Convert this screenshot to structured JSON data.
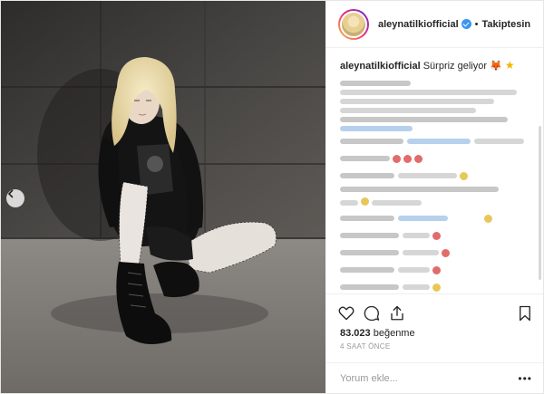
{
  "post": {
    "username": "aleynatilkiofficial",
    "follow_status": "Takiptesin",
    "separator": "•",
    "caption_user": "aleynatilkiofficial",
    "caption_text": "Sürpriz geliyor",
    "caption_emojis": [
      "fox-face",
      "star"
    ],
    "likes_count": "83.023",
    "likes_label": "beğenme",
    "time_ago": "4 SAAT ÖNCE",
    "comment_placeholder": "Yorum ekle...",
    "more_label": "•••"
  },
  "icons": {
    "like": "heart-icon",
    "comment": "comment-icon",
    "share": "share-icon",
    "save": "bookmark-icon",
    "prev": "chevron-left-icon",
    "verified": "verified-badge-icon"
  },
  "colors": {
    "verified_blue": "#3897f0",
    "text": "#262626",
    "muted": "#999999"
  }
}
